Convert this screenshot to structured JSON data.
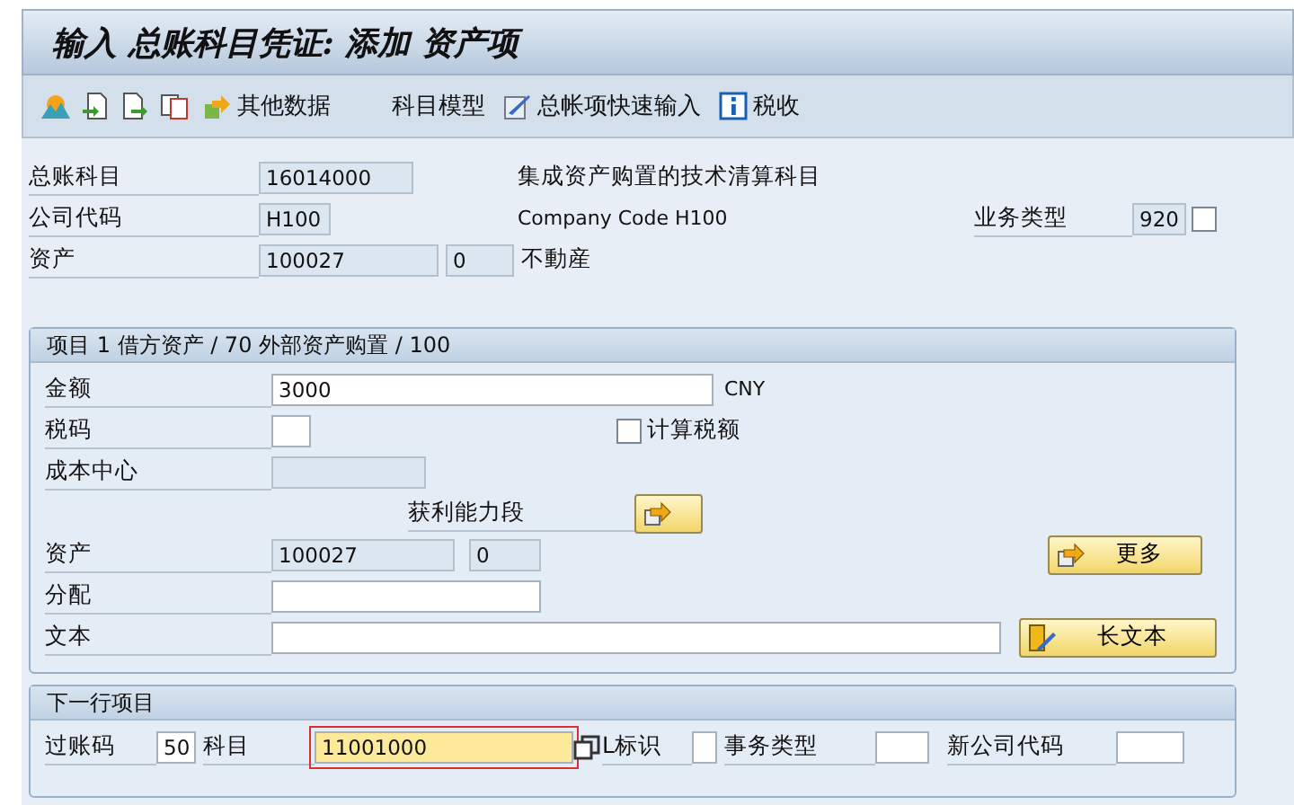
{
  "window": {
    "title": "输入 总账科目凭证: 添加 资产项"
  },
  "toolbar": {
    "other_data": "其他数据",
    "account_model": "科目模型",
    "fast_entry": "总帐项快速输入",
    "tax": "税收"
  },
  "header": {
    "gl_account": {
      "label": "总账科目",
      "value": "16014000",
      "editable": false,
      "description": "集成资产购置的技术清算科目"
    },
    "company_code": {
      "label": "公司代码",
      "value": "H100",
      "editable": false,
      "description": "Company Code H100"
    },
    "business_type": {
      "label": "业务类型",
      "value": "920",
      "editable": false,
      "checked": false
    },
    "asset": {
      "label": "资产",
      "value": "100027",
      "sub_value": "0",
      "editable": false,
      "description": "不動産"
    }
  },
  "item": {
    "title": "项目 1 借方资产 / 70 外部资产购置 / 100",
    "amount": {
      "label": "金额",
      "value": "3000",
      "editable": true,
      "currency": "CNY"
    },
    "tax_code": {
      "label": "税码",
      "editable": true
    },
    "calculate_tax": {
      "label": "计算税额",
      "checked": false
    },
    "cost_center": {
      "label": "成本中心",
      "editable": false
    },
    "profitability_segment": {
      "label": "获利能力段"
    },
    "asset": {
      "label": "资产",
      "value": "100027",
      "sub_value": "0",
      "editable": false
    },
    "more_button": "更多",
    "assignment": {
      "label": "分配",
      "editable": true
    },
    "text": {
      "label": "文本",
      "editable": true
    },
    "long_text_button": "长文本"
  },
  "next_line": {
    "title": "下一行项目",
    "posting_key": {
      "label": "过账码",
      "value": "50",
      "editable": true
    },
    "account": {
      "label": "科目",
      "value": "11001000",
      "editable": true,
      "focused": true
    },
    "special_gl": {
      "label": "L标识",
      "editable": true
    },
    "transaction_type": {
      "label": "事务类型",
      "editable": true
    },
    "new_company_code": {
      "label": "新公司代码",
      "editable": true
    }
  }
}
